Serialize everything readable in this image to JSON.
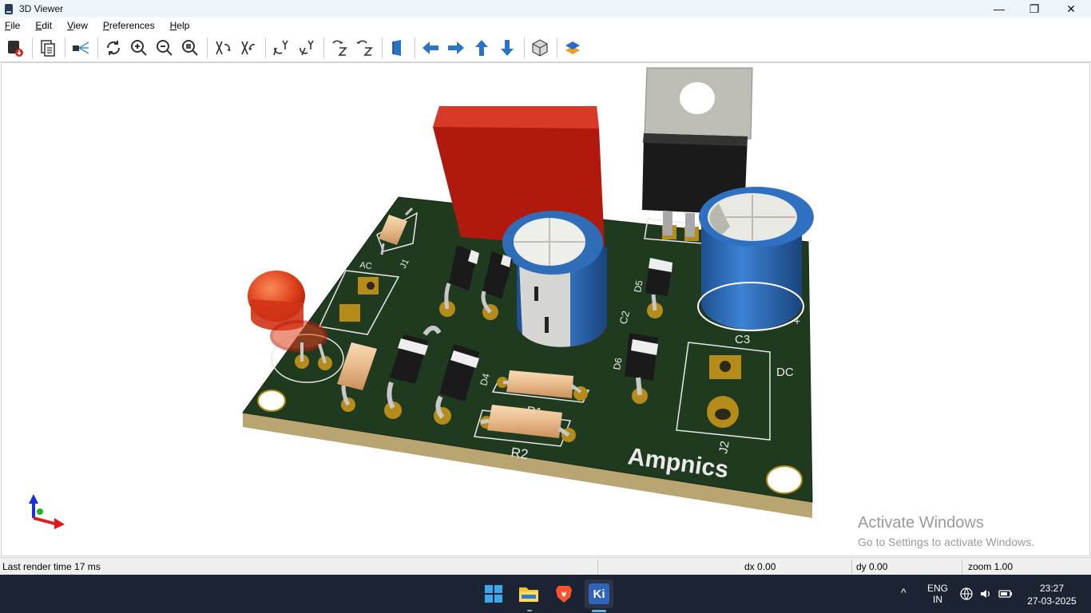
{
  "window": {
    "title": "3D Viewer",
    "minimize_glyph": "—",
    "maximize_glyph": "❐",
    "close_glyph": "✕"
  },
  "menu": [
    "File",
    "Edit",
    "View",
    "Preferences",
    "Help"
  ],
  "toolbar": {
    "icons": [
      "render-raytrace-icon",
      "copy-image-icon",
      "show-viewpoint-icon",
      "reload-icon",
      "zoom-in-icon",
      "zoom-out-icon",
      "zoom-fit-icon",
      "rotate-x-cw-icon",
      "rotate-x-ccw-icon",
      "rotate-y-cw-icon",
      "rotate-y-ccw-icon",
      "rotate-z-cw-icon",
      "rotate-z-ccw-icon",
      "flip-board-icon",
      "pan-left-icon",
      "pan-right-icon",
      "pan-up-icon",
      "pan-down-icon",
      "toggle-orthographic-icon",
      "layers-manager-icon"
    ]
  },
  "board": {
    "silkscreen_brand": "Ampnics",
    "labels": {
      "ac": "AC",
      "j1": "J1",
      "c2": "C2",
      "c3": "C3",
      "d4": "D4",
      "d5": "D5",
      "d6": "D6",
      "dc": "DC",
      "r1": "R1",
      "r2": "R2",
      "j2": "J2",
      "plus": "+"
    },
    "colors": {
      "pcb": "#1f3a1f",
      "pad": "#b58b1a",
      "capacitor_blue": "#2f6db8",
      "film_cap_red": "#c01a10",
      "regulator_black": "#1a1a1a",
      "led_red": "#e23a1a"
    }
  },
  "watermark": {
    "title": "Activate Windows",
    "subtitle": "Go to Settings to activate Windows."
  },
  "status": {
    "render_time": "Last render time 17 ms",
    "dx": "dx 0.00",
    "dy": "dy 0.00",
    "zoom": "zoom 1.00"
  },
  "taskbar": {
    "apps": [
      "windows-start-icon",
      "file-explorer-icon",
      "brave-browser-icon",
      "kicad-icon"
    ],
    "kicad_label": "Ki",
    "lang_line1": "ENG",
    "lang_line2": "IN",
    "tray_caret": "^",
    "time": "23:27",
    "date": "27-03-2025"
  }
}
